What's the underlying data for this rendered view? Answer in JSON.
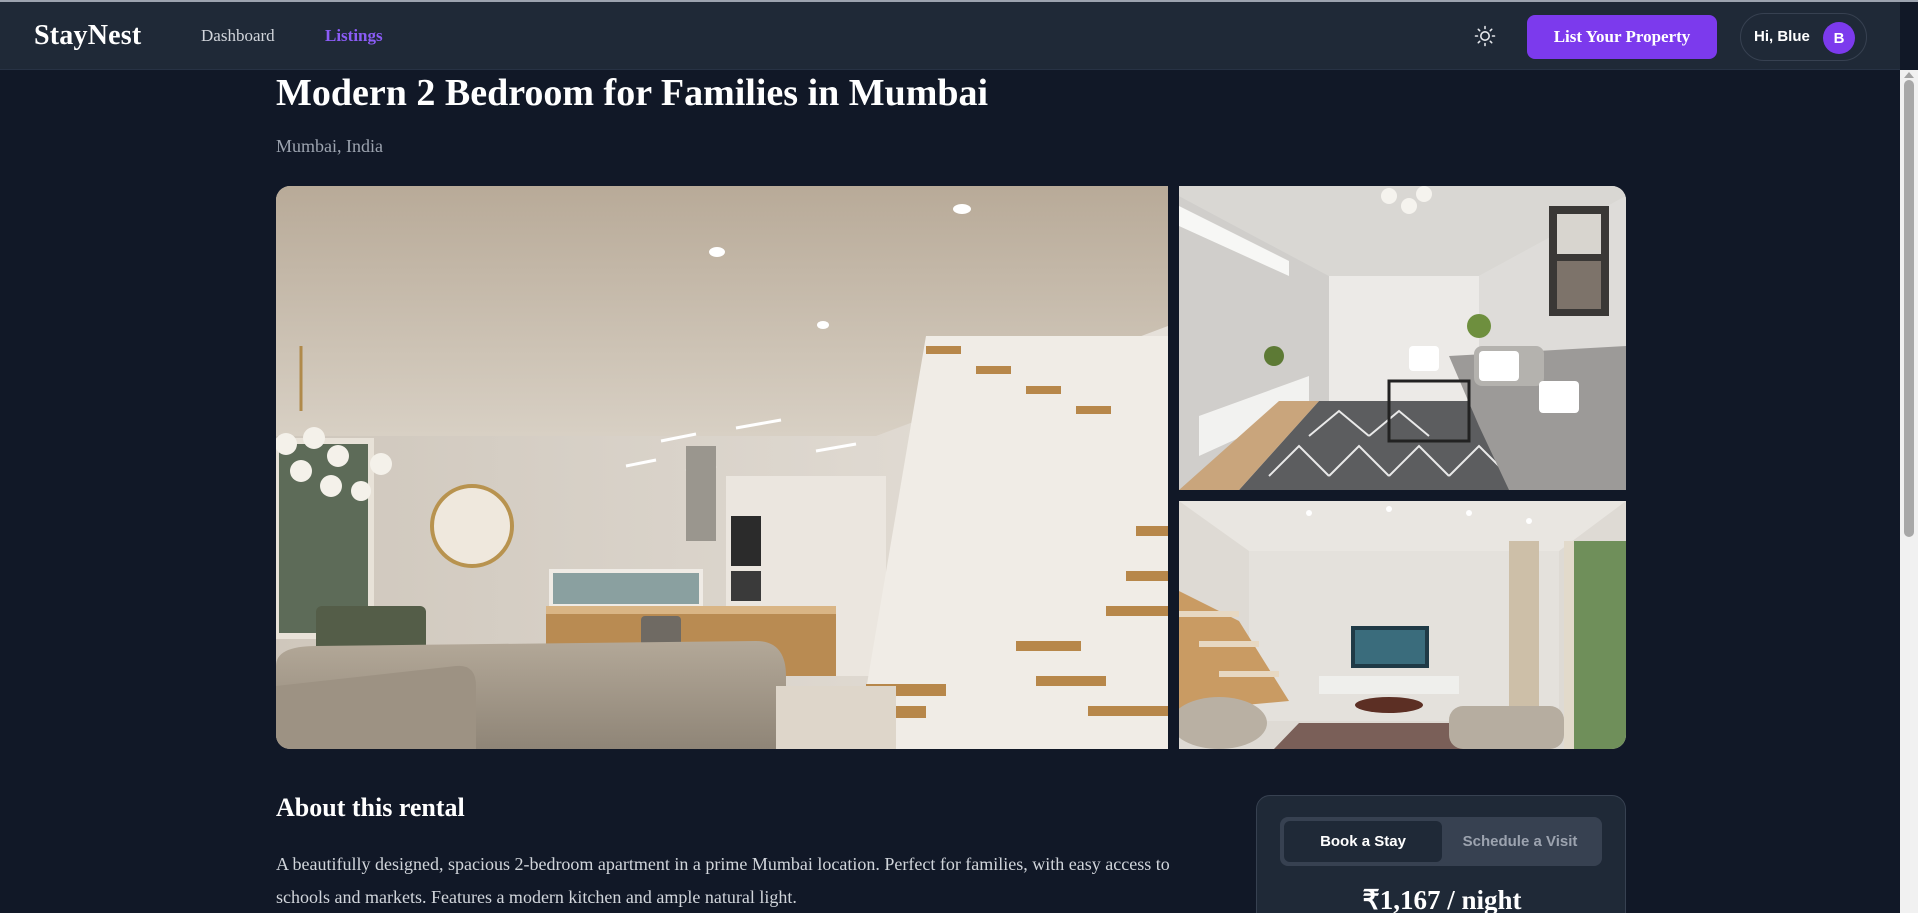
{
  "nav": {
    "brand": "StayNest",
    "links": [
      {
        "label": "Dashboard",
        "active": false
      },
      {
        "label": "Listings",
        "active": true
      }
    ],
    "theme_toggle_icon": "sun-icon",
    "cta_label": "List Your Property",
    "user_greeting": "Hi, Blue",
    "avatar_initial": "B"
  },
  "listing": {
    "title": "Modern 2 Bedroom for Families in Mumbai",
    "location": "Mumbai, India",
    "photos": [
      {
        "name": "open-plan living room with staircase and kitchen"
      },
      {
        "name": "living room with grey sofa and patterned rug"
      },
      {
        "name": "lounge with tv and stairs"
      }
    ]
  },
  "about": {
    "heading": "About this rental",
    "description": "A beautifully designed, spacious 2-bedroom apartment in a prime Mumbai location. Perfect for families, with easy access to schools and markets. Features a modern kitchen and ample natural light."
  },
  "booking": {
    "tabs": [
      {
        "label": "Book a Stay",
        "active": true
      },
      {
        "label": "Schedule a Visit",
        "active": false
      }
    ],
    "price": "₹1,167 / night"
  },
  "colors": {
    "background": "#111827",
    "navbar": "#1f2937",
    "accent": "#7c3aed",
    "active_link": "#8b5cf6"
  }
}
